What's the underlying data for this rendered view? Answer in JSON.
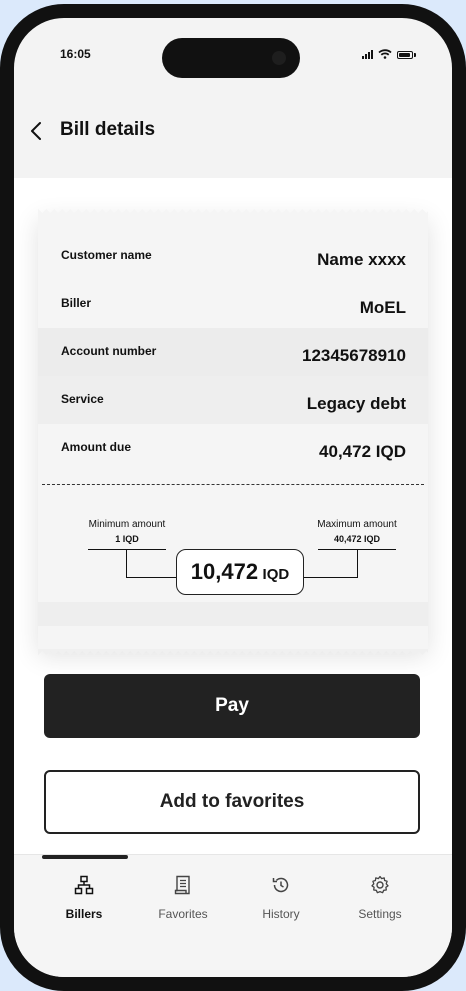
{
  "status_bar": {
    "time": "16:05"
  },
  "header": {
    "title": "Bill details"
  },
  "bill": {
    "rows": [
      {
        "label": "Customer name",
        "value": "Name xxxx"
      },
      {
        "label": "Biller",
        "value": "MoEL"
      },
      {
        "label": "Account number",
        "value": "12345678910"
      },
      {
        "label": "Service",
        "value": "Legacy debt"
      },
      {
        "label": "Amount due",
        "value": "40,472 IQD"
      }
    ],
    "minimum_label": "Minimum amount",
    "minimum_value": "1 IQD",
    "maximum_label": "Maximum amount",
    "maximum_value": "40,472 IQD",
    "amount": "10,472",
    "currency": "IQD"
  },
  "actions": {
    "pay_label": "Pay",
    "favorites_label": "Add to favorites"
  },
  "tabbar": {
    "tabs": [
      {
        "label": "Billers",
        "icon": "sitemap-icon",
        "active": true
      },
      {
        "label": "Favorites",
        "icon": "receipt-icon",
        "active": false
      },
      {
        "label": "History",
        "icon": "history-icon",
        "active": false
      },
      {
        "label": "Settings",
        "icon": "gear-icon",
        "active": false
      }
    ]
  }
}
